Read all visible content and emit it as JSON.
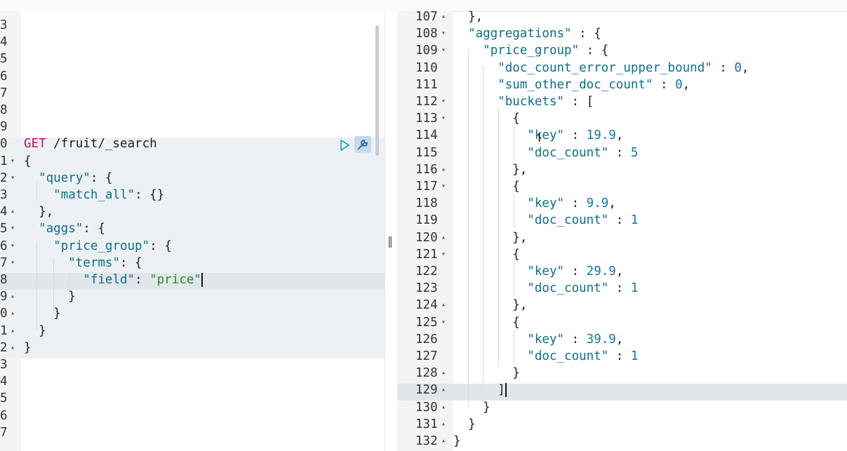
{
  "left": {
    "lines": [
      {
        "n": "3",
        "fold": "",
        "parts": []
      },
      {
        "n": "4",
        "fold": "",
        "parts": []
      },
      {
        "n": "5",
        "fold": "",
        "parts": []
      },
      {
        "n": "6",
        "fold": "",
        "parts": []
      },
      {
        "n": "7",
        "fold": "",
        "parts": []
      },
      {
        "n": "8",
        "fold": "",
        "parts": []
      },
      {
        "n": "9",
        "fold": "",
        "parts": []
      },
      {
        "n": "0",
        "fold": "",
        "parts": [
          [
            "m",
            "GET"
          ],
          [
            "p",
            " /fruit/_search"
          ]
        ]
      },
      {
        "n": "1",
        "fold": "▾",
        "parts": [
          [
            "p",
            "{"
          ]
        ]
      },
      {
        "n": "2",
        "fold": "▾",
        "parts": [
          [
            "p",
            "  "
          ],
          [
            "k",
            "\"query\""
          ],
          [
            "p",
            ": {"
          ]
        ]
      },
      {
        "n": "3",
        "fold": "",
        "parts": [
          [
            "p",
            "    "
          ],
          [
            "k",
            "\"match_all\""
          ],
          [
            "p",
            ": {}"
          ]
        ]
      },
      {
        "n": "4",
        "fold": "▴",
        "parts": [
          [
            "p",
            "  },"
          ]
        ]
      },
      {
        "n": "5",
        "fold": "▾",
        "parts": [
          [
            "p",
            "  "
          ],
          [
            "k",
            "\"aggs\""
          ],
          [
            "p",
            ": {"
          ]
        ]
      },
      {
        "n": "6",
        "fold": "▾",
        "parts": [
          [
            "p",
            "    "
          ],
          [
            "k",
            "\"price_group\""
          ],
          [
            "p",
            ": {"
          ]
        ]
      },
      {
        "n": "7",
        "fold": "▾",
        "parts": [
          [
            "p",
            "      "
          ],
          [
            "k",
            "\"terms\""
          ],
          [
            "p",
            ": {"
          ]
        ]
      },
      {
        "n": "8",
        "fold": "",
        "parts": [
          [
            "p",
            "        "
          ],
          [
            "k",
            "\"field\""
          ],
          [
            "p",
            ": "
          ],
          [
            "s",
            "\"price\""
          ]
        ]
      },
      {
        "n": "9",
        "fold": "▴",
        "parts": [
          [
            "p",
            "      }"
          ]
        ]
      },
      {
        "n": "0",
        "fold": "▴",
        "parts": [
          [
            "p",
            "    }"
          ]
        ]
      },
      {
        "n": "1",
        "fold": "▴",
        "parts": [
          [
            "p",
            "  }"
          ]
        ]
      },
      {
        "n": "2",
        "fold": "▴",
        "parts": [
          [
            "p",
            "}"
          ]
        ]
      },
      {
        "n": "3",
        "fold": "",
        "parts": []
      },
      {
        "n": "4",
        "fold": "",
        "parts": []
      },
      {
        "n": "5",
        "fold": "",
        "parts": []
      },
      {
        "n": "6",
        "fold": "",
        "parts": []
      },
      {
        "n": "7",
        "fold": "",
        "parts": []
      }
    ]
  },
  "right": {
    "lines": [
      {
        "n": "107",
        "fold": "▴",
        "parts": [
          [
            "p",
            "  },"
          ]
        ]
      },
      {
        "n": "108",
        "fold": "▾",
        "parts": [
          [
            "p",
            "  "
          ],
          [
            "k",
            "\"aggregations\""
          ],
          [
            "p",
            " : {"
          ]
        ]
      },
      {
        "n": "109",
        "fold": "▾",
        "parts": [
          [
            "p",
            "    "
          ],
          [
            "k",
            "\"price_group\""
          ],
          [
            "p",
            " : {"
          ]
        ]
      },
      {
        "n": "110",
        "fold": "",
        "parts": [
          [
            "p",
            "      "
          ],
          [
            "k",
            "\"doc_count_error_upper_bound\""
          ],
          [
            "p",
            " : "
          ],
          [
            "v",
            "0"
          ],
          [
            "p",
            ","
          ]
        ]
      },
      {
        "n": "111",
        "fold": "",
        "parts": [
          [
            "p",
            "      "
          ],
          [
            "k",
            "\"sum_other_doc_count\""
          ],
          [
            "p",
            " : "
          ],
          [
            "v",
            "0"
          ],
          [
            "p",
            ","
          ]
        ]
      },
      {
        "n": "112",
        "fold": "▾",
        "parts": [
          [
            "p",
            "      "
          ],
          [
            "k",
            "\"buckets\""
          ],
          [
            "p",
            " : ["
          ]
        ]
      },
      {
        "n": "113",
        "fold": "▾",
        "parts": [
          [
            "p",
            "        {"
          ]
        ]
      },
      {
        "n": "114",
        "fold": "",
        "parts": [
          [
            "p",
            "          "
          ],
          [
            "k",
            "\"key\""
          ],
          [
            "p",
            " : "
          ],
          [
            "v",
            "19.9"
          ],
          [
            "p",
            ","
          ]
        ]
      },
      {
        "n": "115",
        "fold": "",
        "parts": [
          [
            "p",
            "          "
          ],
          [
            "k",
            "\"doc_count\""
          ],
          [
            "p",
            " : "
          ],
          [
            "v",
            "5"
          ]
        ]
      },
      {
        "n": "116",
        "fold": "▴",
        "parts": [
          [
            "p",
            "        },"
          ]
        ]
      },
      {
        "n": "117",
        "fold": "▾",
        "parts": [
          [
            "p",
            "        {"
          ]
        ]
      },
      {
        "n": "118",
        "fold": "",
        "parts": [
          [
            "p",
            "          "
          ],
          [
            "k",
            "\"key\""
          ],
          [
            "p",
            " : "
          ],
          [
            "v",
            "9.9"
          ],
          [
            "p",
            ","
          ]
        ]
      },
      {
        "n": "119",
        "fold": "",
        "parts": [
          [
            "p",
            "          "
          ],
          [
            "k",
            "\"doc_count\""
          ],
          [
            "p",
            " : "
          ],
          [
            "v",
            "1"
          ]
        ]
      },
      {
        "n": "120",
        "fold": "▴",
        "parts": [
          [
            "p",
            "        },"
          ]
        ]
      },
      {
        "n": "121",
        "fold": "▾",
        "parts": [
          [
            "p",
            "        {"
          ]
        ]
      },
      {
        "n": "122",
        "fold": "",
        "parts": [
          [
            "p",
            "          "
          ],
          [
            "k",
            "\"key\""
          ],
          [
            "p",
            " : "
          ],
          [
            "v",
            "29.9"
          ],
          [
            "p",
            ","
          ]
        ]
      },
      {
        "n": "123",
        "fold": "",
        "parts": [
          [
            "p",
            "          "
          ],
          [
            "k",
            "\"doc_count\""
          ],
          [
            "p",
            " : "
          ],
          [
            "v",
            "1"
          ]
        ]
      },
      {
        "n": "124",
        "fold": "▴",
        "parts": [
          [
            "p",
            "        },"
          ]
        ]
      },
      {
        "n": "125",
        "fold": "▾",
        "parts": [
          [
            "p",
            "        {"
          ]
        ]
      },
      {
        "n": "126",
        "fold": "",
        "parts": [
          [
            "p",
            "          "
          ],
          [
            "k",
            "\"key\""
          ],
          [
            "p",
            " : "
          ],
          [
            "v",
            "39.9"
          ],
          [
            "p",
            ","
          ]
        ]
      },
      {
        "n": "127",
        "fold": "",
        "parts": [
          [
            "p",
            "          "
          ],
          [
            "k",
            "\"doc_count\""
          ],
          [
            "p",
            " : "
          ],
          [
            "v",
            "1"
          ]
        ]
      },
      {
        "n": "128",
        "fold": "▴",
        "parts": [
          [
            "p",
            "        }"
          ]
        ]
      },
      {
        "n": "129",
        "fold": "▴",
        "parts": [
          [
            "p",
            "      ]"
          ]
        ]
      },
      {
        "n": "130",
        "fold": "▴",
        "parts": [
          [
            "p",
            "    }"
          ]
        ]
      },
      {
        "n": "131",
        "fold": "▴",
        "parts": [
          [
            "p",
            "  }"
          ]
        ]
      },
      {
        "n": "132",
        "fold": "▴",
        "parts": [
          [
            "p",
            "}"
          ]
        ]
      }
    ]
  },
  "icons": {
    "run": "play-icon",
    "wrench": "wrench-icon"
  }
}
